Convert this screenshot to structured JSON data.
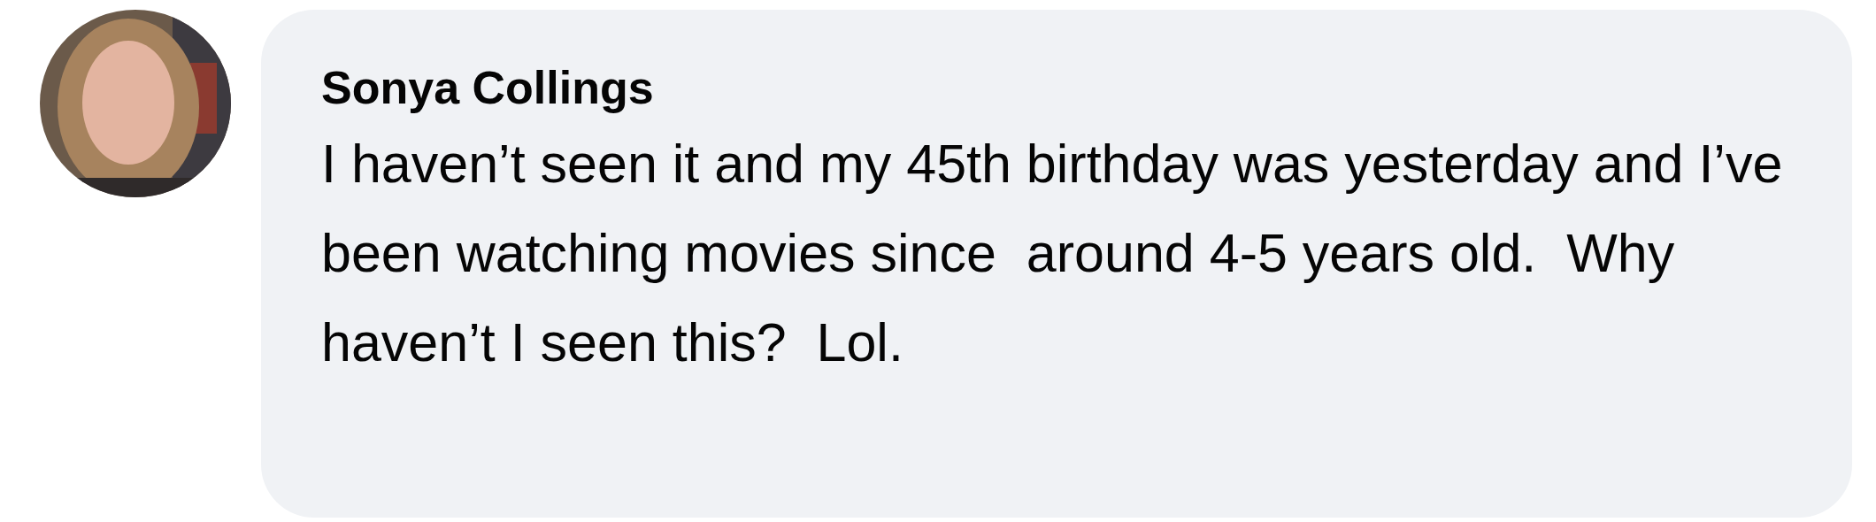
{
  "comment": {
    "author": "Sonya Collings",
    "text": "I haven’t seen it and my 45th birthday was yesterday and I’ve been watching movies since  around 4-5 years old.  Why haven’t I seen this?  Lol."
  }
}
